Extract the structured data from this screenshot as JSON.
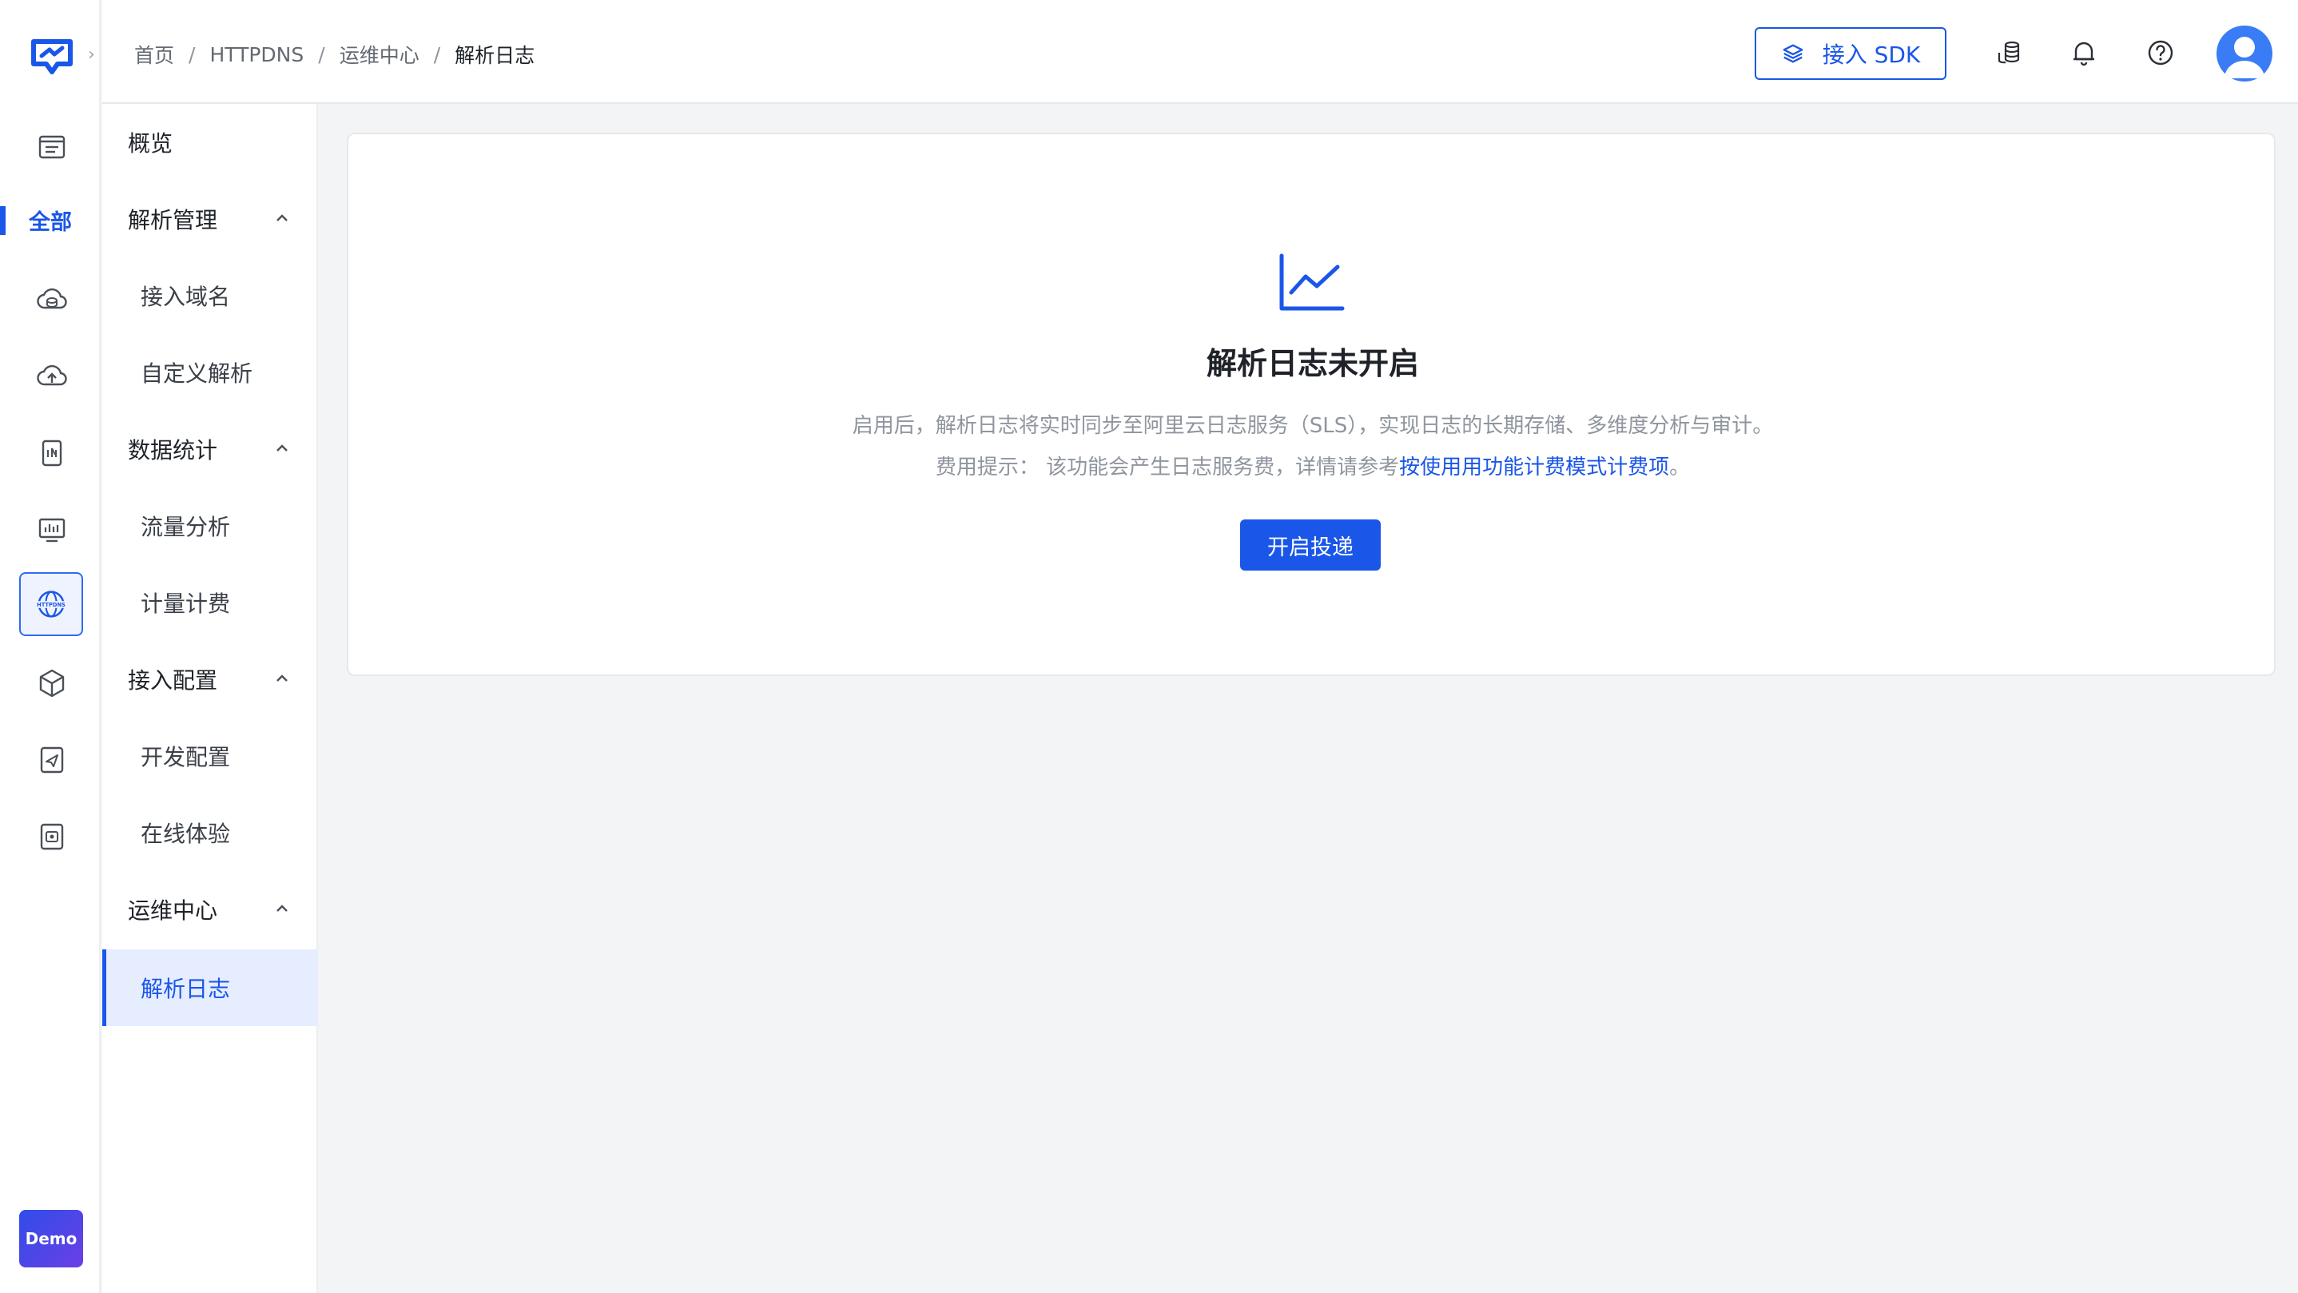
{
  "breadcrumb": [
    "首页",
    "HTTPDNS",
    "运维中心",
    "解析日志"
  ],
  "header": {
    "sdk_button_label": "接入 SDK",
    "icons": [
      "layers-icon",
      "coins-icon",
      "bell-icon",
      "help-icon",
      "avatar"
    ]
  },
  "rail": {
    "all_label": "全部",
    "demo_label": "Demo",
    "icons": [
      "logo-icon",
      "file-list-icon",
      "cloud-dns-icon",
      "cloud-upload-icon",
      "device-icon",
      "monitor-chart-icon",
      "httpdns-globe-icon",
      "cube-icon",
      "send-doc-icon",
      "app-box-icon"
    ]
  },
  "menu": {
    "overview": "概览",
    "groups": [
      {
        "label": "解析管理",
        "children": [
          "接入域名",
          "自定义解析"
        ]
      },
      {
        "label": "数据统计",
        "children": [
          "流量分析",
          "计量计费"
        ]
      },
      {
        "label": "接入配置",
        "children": [
          "开发配置",
          "在线体验"
        ]
      },
      {
        "label": "运维中心",
        "children": [
          "解析日志"
        ]
      }
    ],
    "active": "解析日志"
  },
  "empty_state": {
    "icon": "line-chart-icon",
    "title": "解析日志未开启",
    "description": "启用后，解析日志将实时同步至阿里云日志服务（SLS），实现日志的长期存储、多维度分析与审计。",
    "fee_prefix": "费用提示： 该功能会产生日志服务费，详情请参考",
    "fee_link": "按使用用功能计费模式计费项",
    "fee_suffix": "。",
    "button_label": "开启投递"
  },
  "colors": {
    "accent": "#1a56e8",
    "active_bg": "#e6edff",
    "page_bg": "#f3f4f6"
  }
}
